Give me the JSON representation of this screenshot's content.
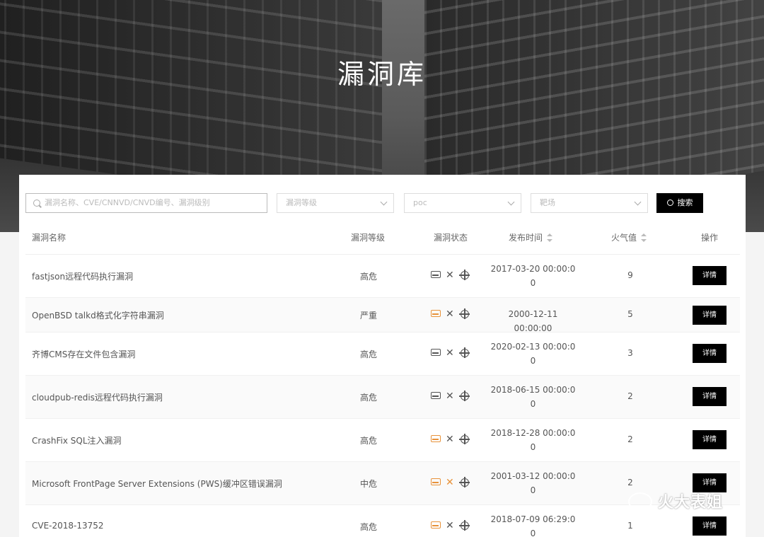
{
  "hero": {
    "title": "漏洞库"
  },
  "filters": {
    "search_placeholder": "漏洞名称、CVE/CNNVD/CNVD编号、漏洞级别",
    "level_placeholder": "漏洞等级",
    "poc_placeholder": "poc",
    "range_placeholder": "靶场",
    "search_button": "搜索"
  },
  "table": {
    "headers": {
      "name": "漏洞名称",
      "level": "漏洞等级",
      "status": "漏洞状态",
      "date": "发布时间",
      "heat": "火气值",
      "op": "操作"
    },
    "rows": [
      {
        "name": "fastjson远程代码执行漏洞",
        "level": "高危",
        "date1": "2017-03-20 00:00:0",
        "date2": "0",
        "heat": "9",
        "op": "详情"
      },
      {
        "name": "OpenBSD talkd格式化字符串漏洞",
        "level": "严重",
        "date1": "2000-12-11 00:00:00",
        "date2": "",
        "heat": "5",
        "op": "详情"
      },
      {
        "name": "齐博CMS存在文件包含漏洞",
        "level": "高危",
        "date1": "2020-02-13 00:00:0",
        "date2": "0",
        "heat": "3",
        "op": "详情"
      },
      {
        "name": "cloudpub-redis远程代码执行漏洞",
        "level": "高危",
        "date1": "2018-06-15 00:00:0",
        "date2": "0",
        "heat": "2",
        "op": "详情"
      },
      {
        "name": "CrashFix SQL注入漏洞",
        "level": "高危",
        "date1": "2018-12-28 00:00:0",
        "date2": "0",
        "heat": "2",
        "op": "详情"
      },
      {
        "name": "Microsoft FrontPage Server Extensions (PWS)缓冲区错误漏洞",
        "level": "中危",
        "date1": "2001-03-12 00:00:0",
        "date2": "0",
        "heat": "2",
        "op": "详情"
      },
      {
        "name": "CVE-2018-13752",
        "level": "高危",
        "date1": "2018-07-09 06:29:0",
        "date2": "0",
        "heat": "1",
        "op": "详情"
      }
    ]
  },
  "watermark": {
    "text": "火大表姐"
  },
  "colors": {
    "warn": "#e8923a",
    "button": "#000000"
  }
}
